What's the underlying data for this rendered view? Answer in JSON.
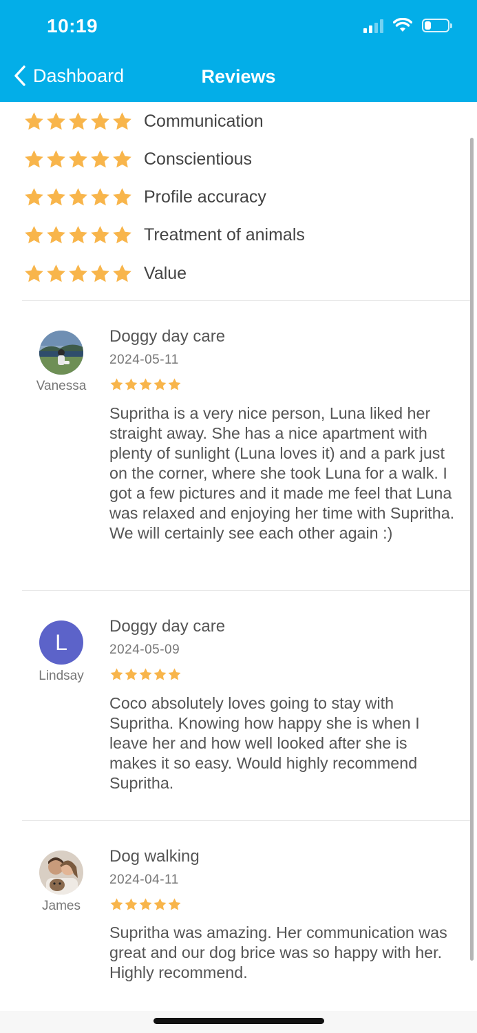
{
  "status_bar": {
    "time": "10:19"
  },
  "nav": {
    "back_label": "Dashboard",
    "title": "Reviews"
  },
  "colors": {
    "header": "#03aee8",
    "star": "#f8b54b",
    "avatar_letter_bg": "#5c63c9"
  },
  "category_ratings": [
    {
      "label": "Communication",
      "stars": 5
    },
    {
      "label": "Conscientious",
      "stars": 5
    },
    {
      "label": "Profile accuracy",
      "stars": 5
    },
    {
      "label": "Treatment of animals",
      "stars": 5
    },
    {
      "label": "Value",
      "stars": 5
    }
  ],
  "reviews": [
    {
      "reviewer": "Vanessa",
      "avatar": "photo",
      "service": "Doggy day care",
      "date": "2024-05-11",
      "stars": 5,
      "text": "Supritha is a very nice person, Luna liked her straight away. She has a nice apartment with plenty of sunlight (Luna loves it) and a park just on the corner, where she took Luna for a walk.  I got a few pictures and it made me feel that Luna was relaxed and enjoying her time with Supritha. We will certainly see each other again :)"
    },
    {
      "reviewer": "Lindsay",
      "avatar": "letter",
      "avatar_letter": "L",
      "service": "Doggy day care",
      "date": "2024-05-09",
      "stars": 5,
      "text": "Coco absolutely loves going to stay with Supritha. Knowing how happy she is when I leave her and how well looked after she is makes it so easy. Would highly recommend Supritha."
    },
    {
      "reviewer": "James",
      "avatar": "photo",
      "service": "Dog walking",
      "date": "2024-04-11",
      "stars": 5,
      "text": "Supritha was amazing. Her communication was great and our dog brice was so happy with her. Highly recommend."
    }
  ]
}
